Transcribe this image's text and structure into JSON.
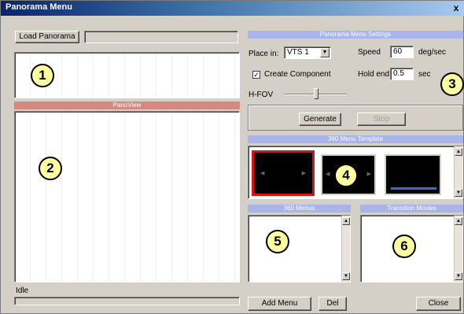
{
  "window": {
    "title": "Panorama Menu",
    "close_label": "x"
  },
  "toolbar": {
    "load_label": "Load Panorama",
    "path_value": ""
  },
  "left": {
    "panoview_header": "PanoView",
    "status_text": "Idle"
  },
  "settings": {
    "header": "Panorama Menu Settings",
    "place_in_label": "Place in:",
    "place_in_value": "VTS 1",
    "speed_label": "Speed",
    "speed_value": "60",
    "speed_unit": "deg/sec",
    "create_component_label": "Create Component",
    "create_component_checked": "✓",
    "hold_end_label": "Hold end",
    "hold_end_value": "0.5",
    "hold_end_unit": "sec",
    "hfov_label": "H-FOV",
    "generate_label": "Generate",
    "stop_label": "Stop"
  },
  "templates": {
    "header": "360 Menu Template"
  },
  "menus": {
    "header": "360 Menus"
  },
  "transitions": {
    "header": "Transition Movies"
  },
  "footer": {
    "add_menu_label": "Add Menu",
    "del_label": "Del",
    "close_label": "Close"
  },
  "callouts": {
    "c1": "1",
    "c2": "2",
    "c3": "3",
    "c4": "4",
    "c5": "5",
    "c6": "6"
  }
}
